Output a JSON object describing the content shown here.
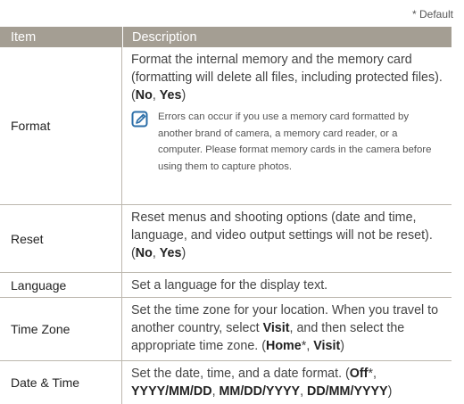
{
  "default_note": "* Default",
  "header": {
    "item": "Item",
    "description": "Description"
  },
  "rows": {
    "format": {
      "item": "Format",
      "desc": "Format the internal memory and the memory card (formatting will delete all files, including protected files). (",
      "opt1": "No",
      "sep": ", ",
      "opt2": "Yes",
      "end": ")",
      "note": "Errors can occur if you use a memory card formatted by another brand of camera, a memory card reader, or a computer. Please format memory cards in the camera before using them to capture photos.",
      "note_icon": "note-pencil-icon"
    },
    "reset": {
      "item": "Reset",
      "desc": "Reset menus and shooting options (date and time, language, and video output settings will not be reset). (",
      "opt1": "No",
      "sep": ", ",
      "opt2": "Yes",
      "end": ")"
    },
    "language": {
      "item": "Language",
      "desc": "Set a language for the display text."
    },
    "timezone": {
      "item": "Time Zone",
      "desc1": "Set the time zone for your location. When you travel to another country, select ",
      "visit": "Visit",
      "desc2": ", and then select the appropriate time zone. (",
      "home": "Home",
      "star": "*",
      "sep": ", ",
      "visit2": "Visit",
      "end": ")"
    },
    "datetime": {
      "item": "Date & Time",
      "desc": "Set the date, time, and a date format. (",
      "off": "Off",
      "star": "*",
      "sep1": ", ",
      "f1": "YYYY/MM/DD",
      "sep2": ", ",
      "f2": "MM/DD/YYYY",
      "sep3": ", ",
      "f3": "DD/MM/YYYY",
      "end": ")"
    }
  },
  "colors": {
    "header_bg": "#a49e93",
    "rule": "#bcb7ae",
    "icon": "#2b6ea8"
  }
}
